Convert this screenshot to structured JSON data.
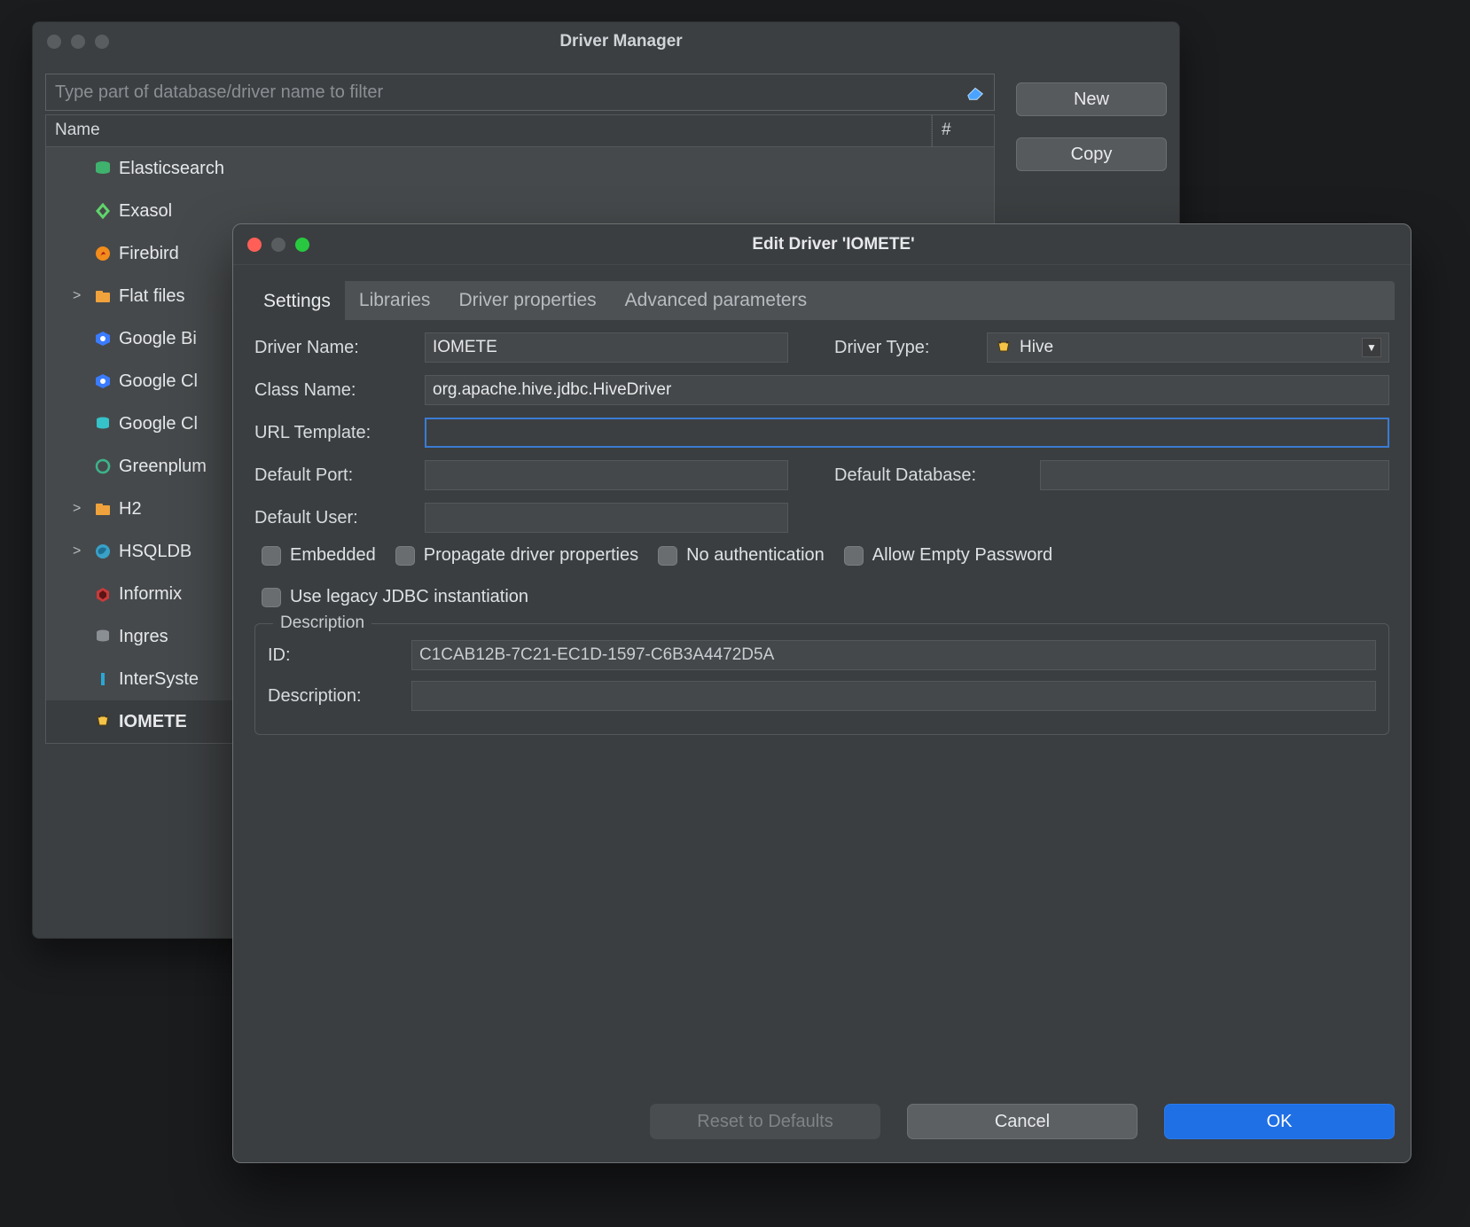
{
  "dm": {
    "title": "Driver Manager",
    "filter_placeholder": "Type part of database/driver name to filter",
    "col_name": "Name",
    "col_hash": "#",
    "buttons": {
      "new": "New",
      "copy": "Copy"
    },
    "drivers": [
      {
        "label": "Elasticsearch",
        "icon": "db-green",
        "caret": ""
      },
      {
        "label": "Exasol",
        "icon": "exasol",
        "caret": ""
      },
      {
        "label": "Firebird",
        "icon": "firebird",
        "caret": ""
      },
      {
        "label": "Flat files",
        "icon": "folder-orange",
        "caret": ">"
      },
      {
        "label": "Google Bi",
        "icon": "google-blue",
        "caret": ""
      },
      {
        "label": "Google Cl",
        "icon": "google-blue",
        "caret": ""
      },
      {
        "label": "Google Cl",
        "icon": "google-teal",
        "caret": ""
      },
      {
        "label": "Greenplum",
        "icon": "greenplum",
        "caret": ""
      },
      {
        "label": "H2",
        "icon": "folder-orange",
        "caret": ">"
      },
      {
        "label": "HSQLDB",
        "icon": "hsqldb",
        "caret": ">"
      },
      {
        "label": "Informix",
        "icon": "informix",
        "caret": ""
      },
      {
        "label": "Ingres",
        "icon": "db-gray",
        "caret": ""
      },
      {
        "label": "InterSyste",
        "icon": "intersystems",
        "caret": ""
      },
      {
        "label": "IOMETE",
        "icon": "iomete",
        "caret": "",
        "selected": true
      }
    ]
  },
  "ed": {
    "title": "Edit Driver 'IOMETE'",
    "tabs": [
      "Settings",
      "Libraries",
      "Driver properties",
      "Advanced parameters"
    ],
    "active_tab": 0,
    "labels": {
      "driver_name": "Driver Name:",
      "driver_type": "Driver Type:",
      "class_name": "Class Name:",
      "url_template": "URL Template:",
      "default_port": "Default Port:",
      "default_database": "Default Database:",
      "default_user": "Default User:",
      "embedded": "Embedded",
      "propagate": "Propagate driver properties",
      "no_auth": "No authentication",
      "allow_empty_pw": "Allow Empty Password",
      "legacy_jdbc": "Use legacy JDBC instantiation",
      "description_group": "Description",
      "id": "ID:",
      "description": "Description:"
    },
    "values": {
      "driver_name": "IOMETE",
      "driver_type": "Hive",
      "class_name": "org.apache.hive.jdbc.HiveDriver",
      "url_template": "",
      "default_port": "",
      "default_database": "",
      "default_user": "",
      "id": "C1CAB12B-7C21-EC1D-1597-C6B3A4472D5A",
      "description": ""
    },
    "buttons": {
      "reset": "Reset to Defaults",
      "cancel": "Cancel",
      "ok": "OK"
    }
  }
}
